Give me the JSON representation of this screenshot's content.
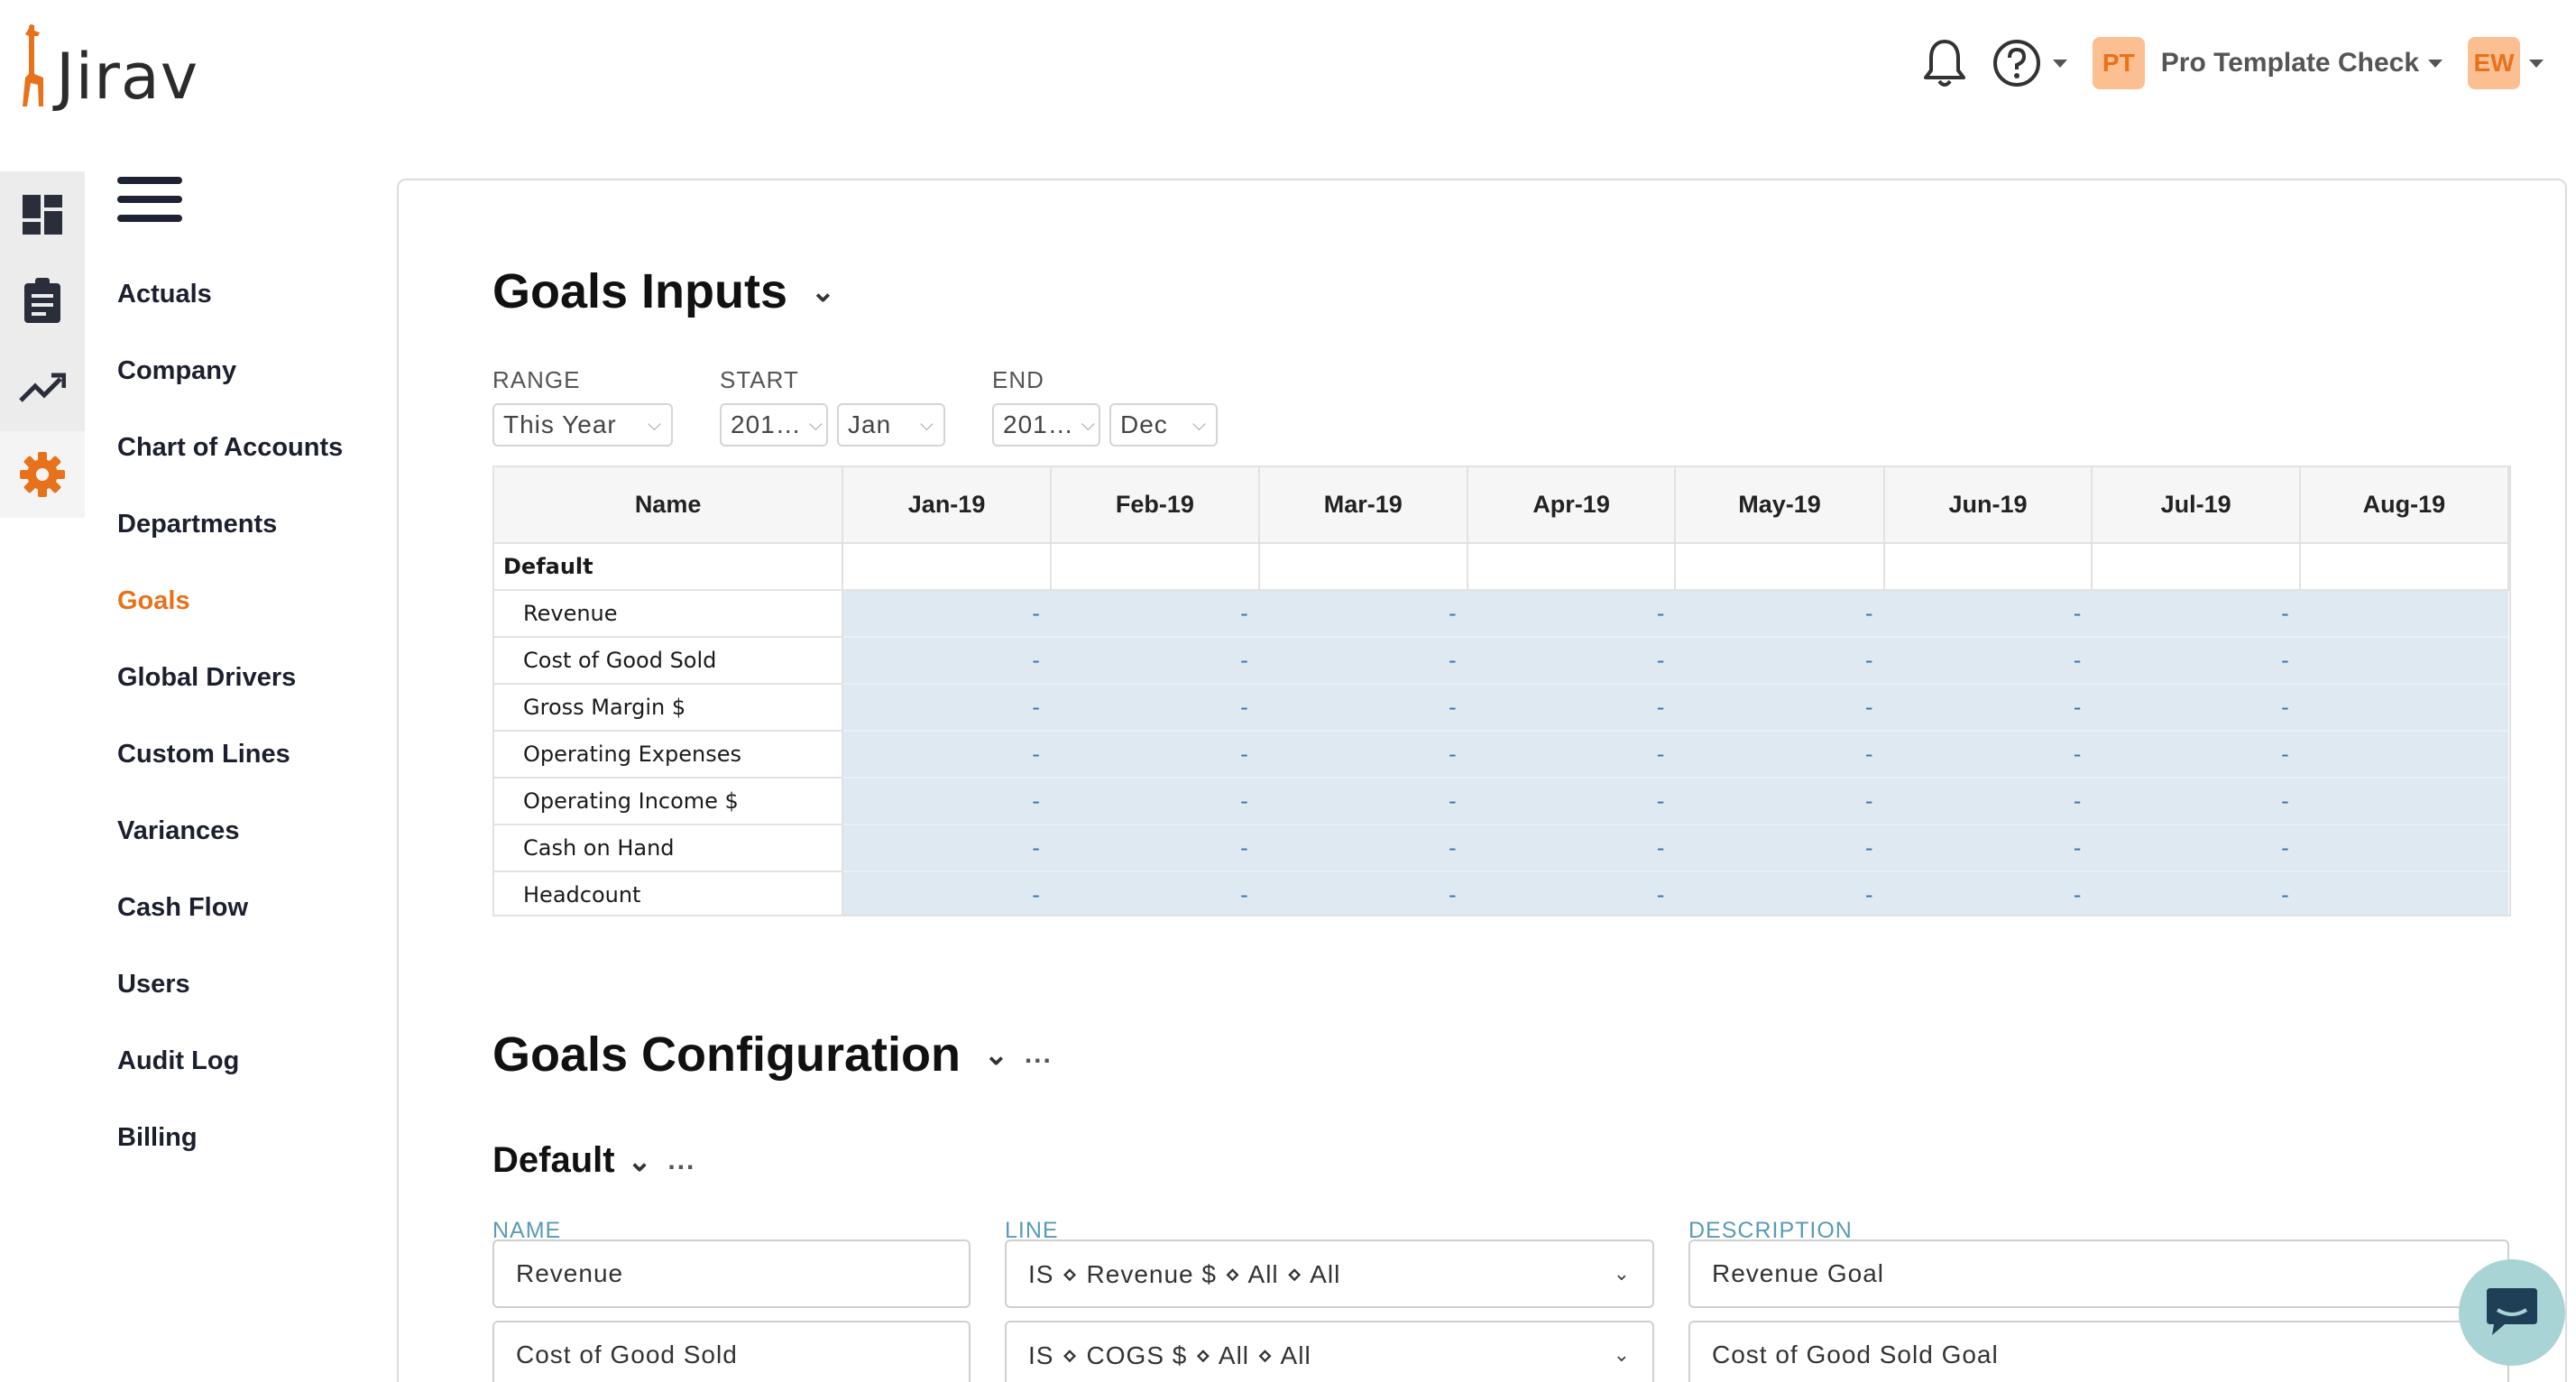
{
  "app": {
    "logo_text": "Jirav"
  },
  "header": {
    "company_initials": "PT",
    "company_name": "Pro Template Check",
    "user_initials": "EW"
  },
  "nav": {
    "items": [
      {
        "label": "Actuals"
      },
      {
        "label": "Company"
      },
      {
        "label": "Chart of Accounts"
      },
      {
        "label": "Departments"
      },
      {
        "label": "Goals",
        "active": true
      },
      {
        "label": "Global Drivers"
      },
      {
        "label": "Custom Lines"
      },
      {
        "label": "Variances"
      },
      {
        "label": "Cash Flow"
      },
      {
        "label": "Users"
      },
      {
        "label": "Audit Log"
      },
      {
        "label": "Billing"
      }
    ]
  },
  "inputs": {
    "title": "Goals Inputs",
    "range_label": "RANGE",
    "range_value": "This Year",
    "start_label": "START",
    "start_year": "201…",
    "start_month": "Jan",
    "end_label": "END",
    "end_year": "201…",
    "end_month": "Dec",
    "table": {
      "name_header": "Name",
      "months": [
        "Jan-19",
        "Feb-19",
        "Mar-19",
        "Apr-19",
        "May-19",
        "Jun-19",
        "Jul-19",
        "Aug-19"
      ],
      "group": "Default",
      "rows": [
        {
          "name": "Revenue",
          "values": [
            "-",
            "-",
            "-",
            "-",
            "-",
            "-",
            "-",
            ""
          ]
        },
        {
          "name": "Cost of Good Sold",
          "values": [
            "-",
            "-",
            "-",
            "-",
            "-",
            "-",
            "-",
            ""
          ]
        },
        {
          "name": "Gross Margin $",
          "values": [
            "-",
            "-",
            "-",
            "-",
            "-",
            "-",
            "-",
            ""
          ]
        },
        {
          "name": "Operating Expenses",
          "values": [
            "-",
            "-",
            "-",
            "-",
            "-",
            "-",
            "-",
            ""
          ]
        },
        {
          "name": "Operating Income $",
          "values": [
            "-",
            "-",
            "-",
            "-",
            "-",
            "-",
            "-",
            ""
          ]
        },
        {
          "name": "Cash on Hand",
          "values": [
            "-",
            "-",
            "-",
            "-",
            "-",
            "-",
            "-",
            ""
          ]
        },
        {
          "name": "Headcount",
          "values": [
            "-",
            "-",
            "-",
            "-",
            "-",
            "-",
            "-",
            ""
          ]
        }
      ]
    }
  },
  "config": {
    "title": "Goals Configuration",
    "more": "...",
    "group_title": "Default",
    "name_label": "NAME",
    "line_label": "LINE",
    "description_label": "DESCRIPTION",
    "rows": [
      {
        "name": "Revenue",
        "line": "IS ⋄ Revenue $ ⋄ All ⋄ All",
        "description": "Revenue Goal"
      },
      {
        "name": "Cost of Good Sold",
        "line": "IS ⋄ COGS $ ⋄ All ⋄ All",
        "description": "Cost of Good Sold Goal"
      }
    ]
  },
  "colors": {
    "accent": "#e8721c",
    "grid_fill": "#dfe9f1",
    "label_blue": "#5a9bb5",
    "chat": "#a9d4d6"
  }
}
